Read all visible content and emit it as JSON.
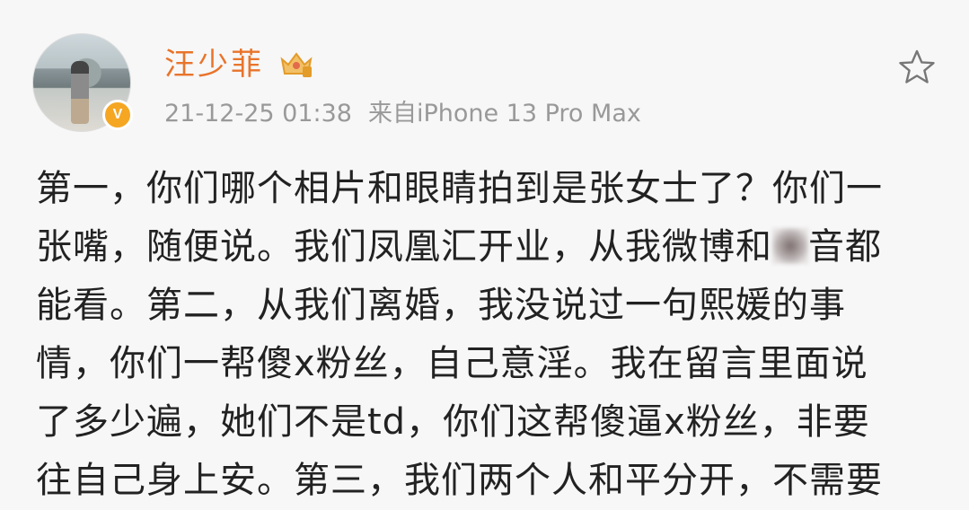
{
  "post": {
    "author": "汪少菲",
    "verified_badge": "V",
    "timestamp": "21-12-25 01:38",
    "source": "来自iPhone 13 Pro Max",
    "icons": {
      "avatar": "avatar",
      "crown": "crown-icon",
      "favorite": "star-icon"
    },
    "accent_color": "#e8742b",
    "body_lines": [
      {
        "pre": "第一，你们哪个相片和眼睛拍到是张女士了？你们一",
        "post": ""
      },
      {
        "pre": "张嘴，随便说。我们凤凰汇开业，从我微博和",
        "post": "音都"
      },
      {
        "pre": "能看。第二，从我们离婚，我没说过一句熙媛的事",
        "post": ""
      },
      {
        "pre": "情，你们一帮傻x粉丝，自己意淫。我在留言里面说",
        "post": ""
      },
      {
        "pre": "了多少遍，她们不是td，你们这帮傻逼x粉丝，非要",
        "post": ""
      },
      {
        "pre": "往自己身上安。第三，我们两个人和平分开，不需要",
        "post": ""
      }
    ]
  }
}
